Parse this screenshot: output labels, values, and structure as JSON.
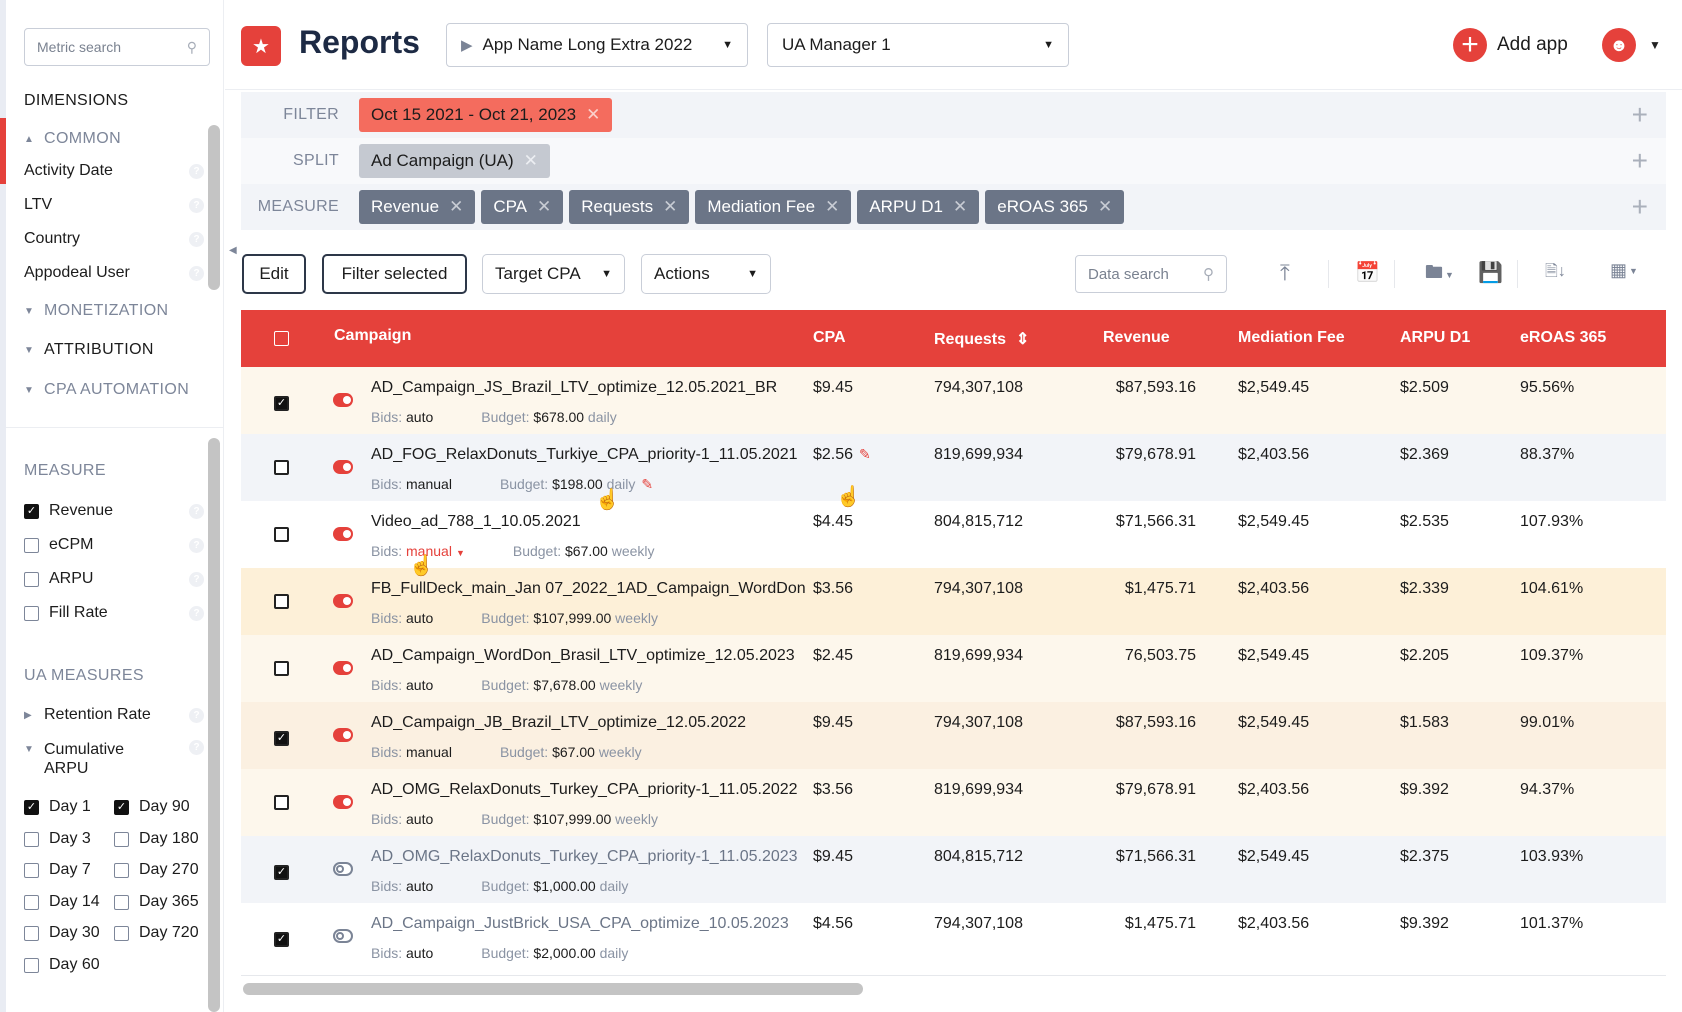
{
  "sidebar": {
    "search_placeholder": "Metric search",
    "dimensions_title": "DIMENSIONS",
    "common_label": "COMMON",
    "common_items": [
      {
        "label": "Activity Date"
      },
      {
        "label": "LTV"
      },
      {
        "label": "Country"
      },
      {
        "label": "Appodeal User"
      }
    ],
    "monetization_label": "MONETIZATION",
    "attribution_label": "ATTRIBUTION",
    "cpa_automation_label": "CPA AUTOMATION",
    "measure_title": "MEASURE",
    "measure_items": [
      {
        "label": "Revenue",
        "checked": true
      },
      {
        "label": "eCPM",
        "checked": false
      },
      {
        "label": "ARPU",
        "checked": false
      },
      {
        "label": "Fill Rate",
        "checked": false
      }
    ],
    "ua_measures_title": "UA MEASURES",
    "retention_rate_label": "Retention Rate",
    "cumulative_arpu_label": "Cumulative ARPU",
    "days": [
      {
        "label": "Day 1",
        "checked": true
      },
      {
        "label": "Day 3",
        "checked": false
      },
      {
        "label": "Day 7",
        "checked": false
      },
      {
        "label": "Day 14",
        "checked": false
      },
      {
        "label": "Day 30",
        "checked": false
      },
      {
        "label": "Day 60",
        "checked": false
      },
      {
        "label": "Day 90",
        "checked": true
      },
      {
        "label": "Day 180",
        "checked": false
      },
      {
        "label": "Day 270",
        "checked": false
      },
      {
        "label": "Day 365",
        "checked": false
      },
      {
        "label": "Day 720",
        "checked": false
      }
    ]
  },
  "header": {
    "title": "Reports",
    "app_select": "App Name Long Extra 2022",
    "manager_select": "UA Manager 1",
    "add_app_label": "Add app"
  },
  "filters": {
    "filter_label": "FILTER",
    "filter_chip": "Oct 15 2021 - Oct 21, 2023",
    "split_label": "SPLIT",
    "split_chip": "Ad Campaign (UA)",
    "measure_label": "MEASURE",
    "measure_chips": [
      "Revenue",
      "CPA",
      "Requests",
      "Mediation Fee",
      "ARPU D1",
      "eROAS 365"
    ]
  },
  "toolbar": {
    "edit_label": "Edit",
    "filter_selected_label": "Filter selected",
    "target_cpa_label": "Target CPA",
    "actions_label": "Actions",
    "data_search_placeholder": "Data search"
  },
  "table": {
    "headers": {
      "campaign": "Campaign",
      "cpa": "CPA",
      "requests": "Requests",
      "revenue": "Revenue",
      "mediation_fee": "Mediation Fee",
      "arpu_d1": "ARPU D1",
      "eroas_365": "eROAS 365"
    },
    "bids_label": "Bids:",
    "budget_label": "Budget:",
    "rows": [
      {
        "checked": true,
        "active": true,
        "campaign": "AD_Campaign_JS_Brazil_LTV_optimize_12.05.2021_BR",
        "bids": "auto",
        "budget": "$678.00",
        "period": "daily",
        "cpa": "$9.45",
        "requests": "794,307,108",
        "revenue": "$87,593.16",
        "mediation_fee": "$2,549.45",
        "arpu_d1": "$2.509",
        "eroas_365": "95.56%",
        "bg": "#fdf7ec"
      },
      {
        "checked": false,
        "active": true,
        "campaign": "AD_FOG_RelaxDonuts_Turkiye_CPA_priority-1_11.05.2021",
        "bids": "manual",
        "budget": "$198.00",
        "period": "daily",
        "cpa": "$2.56",
        "requests": "819,699,934",
        "revenue": "$79,678.91",
        "mediation_fee": "$2,403.56",
        "arpu_d1": "$2.369",
        "eroas_365": "88.37%",
        "bg": "#f2f4f8",
        "editable": true
      },
      {
        "checked": false,
        "active": true,
        "campaign": "Video_ad_788_1_10.05.2021",
        "bids": "manual",
        "bids_dropdown": true,
        "budget": "$67.00",
        "period": "weekly",
        "cpa": "$4.45",
        "requests": "804,815,712",
        "revenue": "$71,566.31",
        "mediation_fee": "$2,549.45",
        "arpu_d1": "$2.535",
        "eroas_365": "107.93%",
        "bg": "#ffffff"
      },
      {
        "checked": false,
        "active": true,
        "campaign": "FB_FullDeck_main_Jan 07_2022_1AD_Campaign_WordDon",
        "bids": "auto",
        "budget": "$107,999.00",
        "period": "weekly",
        "cpa": "$3.56",
        "requests": "794,307,108",
        "revenue": "$1,475.71",
        "mediation_fee": "$2,403.56",
        "arpu_d1": "$2.339",
        "eroas_365": "104.61%",
        "bg": "#fdf0d8"
      },
      {
        "checked": false,
        "active": true,
        "campaign": "AD_Campaign_WordDon_Brasil_LTV_optimize_12.05.2023",
        "bids": "auto",
        "budget": "$7,678.00",
        "period": "weekly",
        "cpa": "$2.45",
        "requests": "819,699,934",
        "revenue": "76,503.75",
        "mediation_fee": "$2,549.45",
        "arpu_d1": "$2.205",
        "eroas_365": "109.37%",
        "bg": "#fdf7ec"
      },
      {
        "checked": true,
        "active": true,
        "campaign": "AD_Campaign_JB_Brazil_LTV_optimize_12.05.2022",
        "bids": "manual",
        "budget": "$67.00",
        "period": "weekly",
        "cpa": "$9.45",
        "requests": "794,307,108",
        "revenue": "$87,593.16",
        "mediation_fee": "$2,549.45",
        "arpu_d1": "$1.583",
        "eroas_365": "99.01%",
        "bg": "#fbf0e1"
      },
      {
        "checked": false,
        "active": true,
        "campaign": "AD_OMG_RelaxDonuts_Turkey_CPA_priority-1_11.05.2022",
        "bids": "auto",
        "budget": "$107,999.00",
        "period": "weekly",
        "cpa": "$3.56",
        "requests": "819,699,934",
        "revenue": "$79,678.91",
        "mediation_fee": "$2,403.56",
        "arpu_d1": "$9.392",
        "eroas_365": "94.37%",
        "bg": "#fdf7ec"
      },
      {
        "checked": true,
        "active": false,
        "campaign": "AD_OMG_RelaxDonuts_Turkey_CPA_priority-1_11.05.2023",
        "bids": "auto",
        "budget": "$1,000.00",
        "period": "daily",
        "cpa": "$9.45",
        "requests": "804,815,712",
        "revenue": "$71,566.31",
        "mediation_fee": "$2,549.45",
        "arpu_d1": "$2.375",
        "eroas_365": "103.93%",
        "bg": "#f2f4f8"
      },
      {
        "checked": true,
        "active": false,
        "campaign": "AD_Campaign_JustBrick_USA_CPA_optimize_10.05.2023",
        "bids": "auto",
        "budget": "$2,000.00",
        "period": "daily",
        "cpa": "$4.56",
        "requests": "794,307,108",
        "revenue": "$1,475.71",
        "mediation_fee": "$2,403.56",
        "arpu_d1": "$9.392",
        "eroas_365": "101.37%",
        "bg": "#ffffff"
      }
    ]
  },
  "colors": {
    "accent": "#e5413b",
    "title": "#1d2a44",
    "chip_filter": "#f46c5e",
    "chip_measure": "#6b7587"
  }
}
